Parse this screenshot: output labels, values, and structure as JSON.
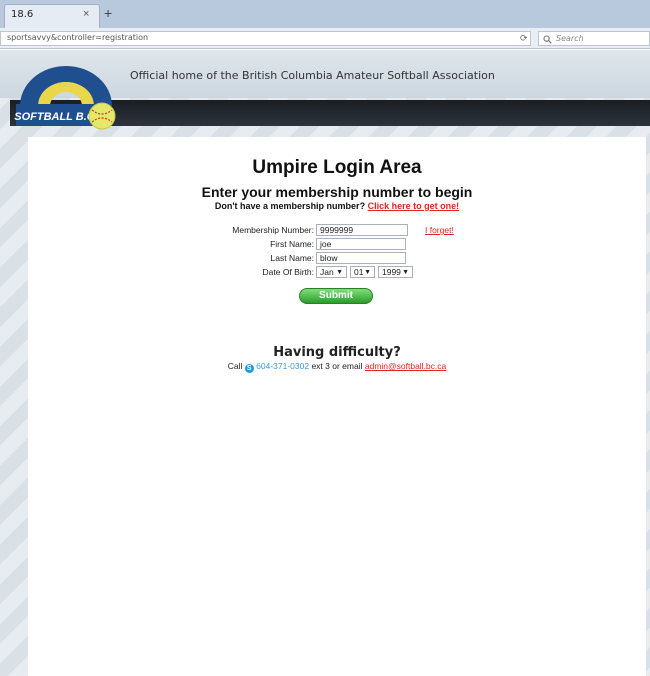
{
  "browser": {
    "tab_title": "18.6",
    "tab_close": "×",
    "new_tab": "+",
    "url": "sportsavvy&controller=registration",
    "reload_icon": "⟳",
    "search_placeholder": "Search"
  },
  "site": {
    "tagline": "Official home of the British Columbia Amateur Softball Association",
    "logo_text": "SOFTBALL B.C."
  },
  "main": {
    "title": "Umpire Login Area",
    "subtitle": "Enter your membership number to begin",
    "prompt": "Don't have a membership number?",
    "register_link": "Click here to get one!",
    "form": {
      "membership_label": "Membership Number:",
      "membership_value": "9999999",
      "forgot_link": "I forget!",
      "first_name_label": "First Name:",
      "first_name_value": "joe",
      "last_name_label": "Last Name:",
      "last_name_value": "blow",
      "dob_label": "Date Of Birth:",
      "dob_month": "Jan",
      "dob_day": "01",
      "dob_year": "1999",
      "submit_label": "Submit"
    },
    "help": {
      "heading": "Having difficulty?",
      "call_text": "Call",
      "phone": "604-371-0302",
      "ext_text": "ext 3 or email",
      "email": "admin@softball.bc.ca"
    }
  },
  "colors": {
    "link_red": "#e52323",
    "submit_green": "#2e9b2a",
    "phone_blue": "#3c9bd8"
  }
}
